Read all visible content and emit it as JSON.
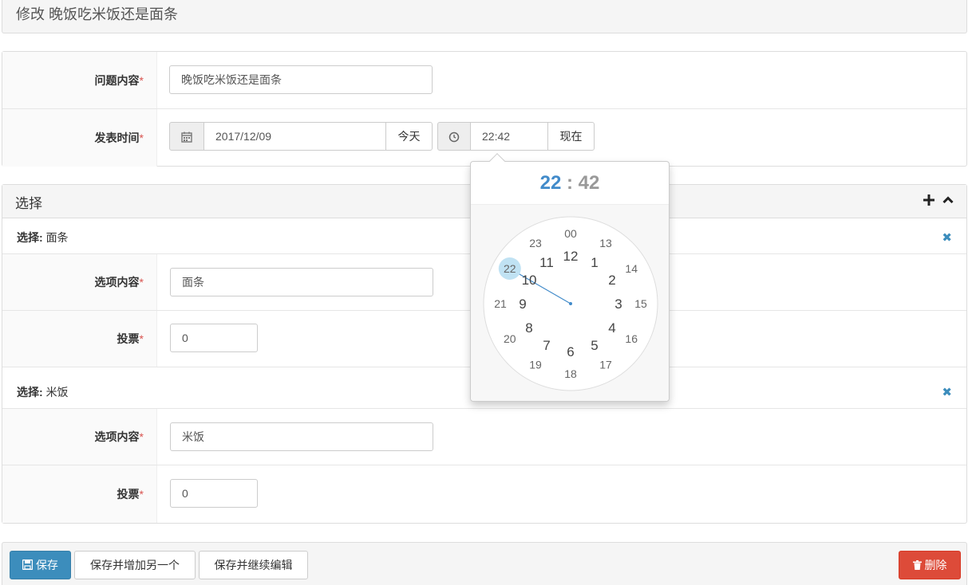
{
  "page": {
    "title": "修改 晚饭吃米饭还是面条"
  },
  "form": {
    "question": {
      "label": "问题内容",
      "value": "晚饭吃米饭还是面条"
    },
    "publish_time": {
      "label": "发表时间",
      "date": "2017/12/09",
      "today_button": "今天",
      "time": "22:42",
      "now_button": "现在"
    },
    "required_mark": "*"
  },
  "choices_box": {
    "title": "选择",
    "add_icon": "plus-icon",
    "collapse_icon": "chevron-up-icon",
    "items": [
      {
        "heading": "选择:",
        "name": "面条",
        "content_label": "选项内容",
        "content_value": "面条",
        "votes_label": "投票",
        "votes_value": "0"
      },
      {
        "heading": "选择:",
        "name": "米饭",
        "content_label": "选项内容",
        "content_value": "米饭",
        "votes_label": "投票",
        "votes_value": "0"
      }
    ]
  },
  "clock_picker": {
    "hours": "22",
    "separator": ":",
    "minutes": "42",
    "selected_hour": "22",
    "accent_color": "#428bca",
    "inner_hours": [
      "12",
      "1",
      "2",
      "3",
      "4",
      "5",
      "6",
      "7",
      "8",
      "9",
      "10",
      "11"
    ],
    "outer_hours": [
      "00",
      "13",
      "14",
      "15",
      "16",
      "17",
      "18",
      "19",
      "20",
      "21",
      "22",
      "23"
    ]
  },
  "footer": {
    "save": "保存",
    "save_add": "保存并增加另一个",
    "save_continue": "保存并继续编辑",
    "delete": "删除"
  }
}
